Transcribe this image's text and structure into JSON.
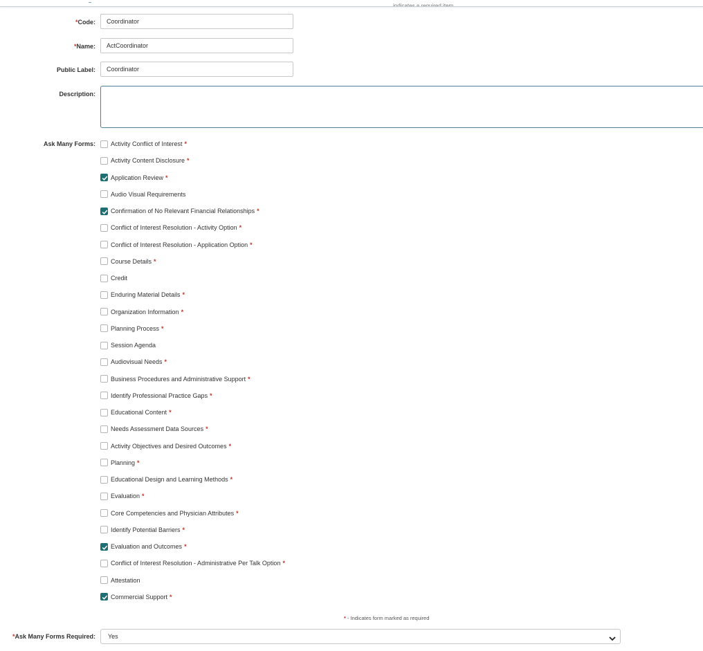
{
  "header": {
    "required_note": "indicates a required item."
  },
  "form": {
    "code": {
      "label": "Code:",
      "value": "Coordinator"
    },
    "name": {
      "label": "Name:",
      "value": "ActCoordinator"
    },
    "public_label": {
      "label": "Public Label:",
      "value": "Coordinator"
    },
    "description": {
      "label": "Description:",
      "value": ""
    },
    "ask_many_forms": {
      "label": "Ask Many Forms:",
      "options": [
        {
          "label": "Activity Conflict of Interest",
          "checked": false,
          "required": true
        },
        {
          "label": "Activity Content Disclosure",
          "checked": false,
          "required": true
        },
        {
          "label": "Application Review",
          "checked": true,
          "required": true
        },
        {
          "label": "Audio Visual Requirements",
          "checked": false,
          "required": false
        },
        {
          "label": "Confirmation of No Relevant Financial Relationships",
          "checked": true,
          "required": true
        },
        {
          "label": "Conflict of Interest Resolution - Activity Option",
          "checked": false,
          "required": true
        },
        {
          "label": "Conflict of Interest Resolution - Application Option",
          "checked": false,
          "required": true
        },
        {
          "label": "Course Details",
          "checked": false,
          "required": true
        },
        {
          "label": "Credit",
          "checked": false,
          "required": false
        },
        {
          "label": "Enduring Material Details",
          "checked": false,
          "required": true
        },
        {
          "label": "Organization Information",
          "checked": false,
          "required": true
        },
        {
          "label": "Planning Process",
          "checked": false,
          "required": true
        },
        {
          "label": "Session Agenda",
          "checked": false,
          "required": false
        },
        {
          "label": "Audiovisual Needs",
          "checked": false,
          "required": true
        },
        {
          "label": "Business Procedures and Administrative Support",
          "checked": false,
          "required": true
        },
        {
          "label": "Identify Professional Practice Gaps",
          "checked": false,
          "required": true
        },
        {
          "label": "Educational Content",
          "checked": false,
          "required": true
        },
        {
          "label": "Needs Assessment Data Sources",
          "checked": false,
          "required": true
        },
        {
          "label": "Activity Objectives and Desired Outcomes",
          "checked": false,
          "required": true
        },
        {
          "label": "Planning",
          "checked": false,
          "required": true
        },
        {
          "label": "Educational Design and Learning Methods",
          "checked": false,
          "required": true
        },
        {
          "label": "Evaluation",
          "checked": false,
          "required": true
        },
        {
          "label": "Core Competencies and Physician Attributes",
          "checked": false,
          "required": true
        },
        {
          "label": "Identify Potential Barriers",
          "checked": false,
          "required": true
        },
        {
          "label": "Evaluation and Outcomes",
          "checked": true,
          "required": true
        },
        {
          "label": "Conflict of Interest Resolution - Administrative Per Talk Option",
          "checked": false,
          "required": true
        },
        {
          "label": "Attestation",
          "checked": false,
          "required": false
        },
        {
          "label": "Commercial Support",
          "checked": true,
          "required": true
        }
      ],
      "legend": "- Indicates form marked as required"
    },
    "ask_many_forms_required": {
      "label": "Ask Many Forms Required:",
      "value": "Yes"
    },
    "required_marker": "*"
  },
  "colors": {
    "checkbox_checked": "#1e6f73",
    "required_star": "#c0392b",
    "textarea_border": "#4f7f96"
  }
}
